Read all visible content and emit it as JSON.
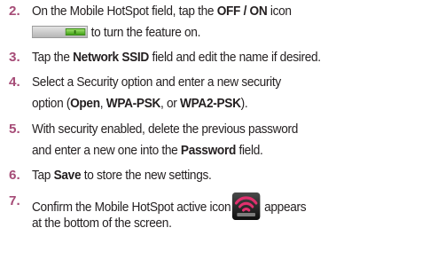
{
  "steps": [
    {
      "number": "2.",
      "line1_before": "On the Mobile HotSpot field, tap the ",
      "line1_bold": "OFF / ON",
      "line1_after": " icon",
      "line2_text": "to turn the feature on."
    },
    {
      "number": "3.",
      "before": "Tap the ",
      "bold": "Network SSID",
      "after": " field and edit the name if desired."
    },
    {
      "number": "4.",
      "line1": "Select a Security option and enter a new security",
      "line2_before": "option (",
      "opt1": "Open",
      "sep1": ", ",
      "opt2": "WPA-PSK",
      "sep2": ", or ",
      "opt3": "WPA2-PSK",
      "line2_after": ")."
    },
    {
      "number": "5.",
      "line1": "With security enabled, delete the previous password",
      "line2_before": "and enter a new one into the ",
      "line2_bold": "Password",
      "line2_after": " field."
    },
    {
      "number": "6.",
      "before": "Tap ",
      "bold": "Save",
      "after": " to store the new settings."
    },
    {
      "number": "7.",
      "line1_before": "Confirm the Mobile HotSpot active icon",
      "line1_after": "appears",
      "line2": "at the bottom of the screen."
    }
  ],
  "icons": {
    "toggle": "toggle-switch-on-icon",
    "hotspot": "mobile-hotspot-icon",
    "accent_color": "#a64c77",
    "toggle_green": "#4caf1f",
    "hotspot_signal": "#e0306e"
  }
}
